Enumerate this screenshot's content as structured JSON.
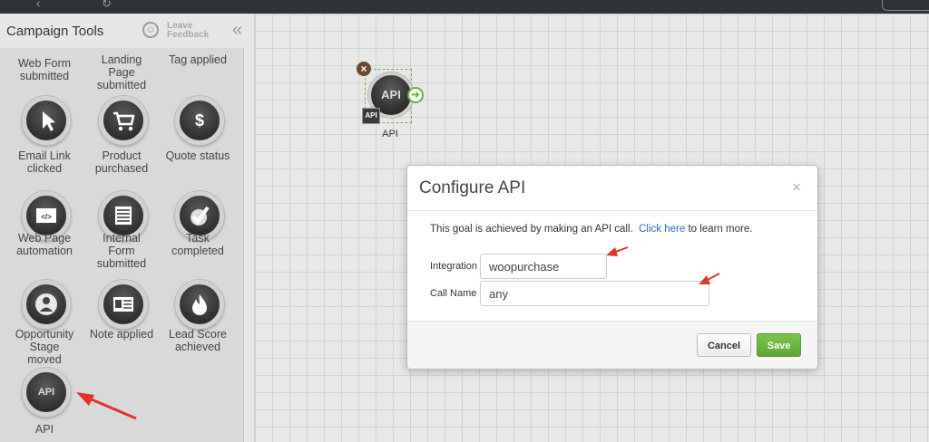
{
  "sidebar": {
    "title": "Campaign Tools",
    "feedback": "Leave\nFeedback",
    "collapse": "«",
    "tools": [
      {
        "label": "Web Form\nsubmitted"
      },
      {
        "label": "Landing\nPage\nsubmitted"
      },
      {
        "label": "Tag applied"
      },
      {
        "label": "Email Link\nclicked",
        "icon": "cursor-icon"
      },
      {
        "label": "Product\npurchased",
        "icon": "cart-icon"
      },
      {
        "label": "Quote status",
        "icon": "dollar-icon"
      },
      {
        "label": "Web Page\nautomation",
        "icon": "code-icon"
      },
      {
        "label": "Internal\nForm\nsubmitted",
        "icon": "form-icon"
      },
      {
        "label": "Task\ncompleted",
        "icon": "checkmark-icon"
      },
      {
        "label": "Opportunity\nStage\nmoved",
        "icon": "person-icon"
      },
      {
        "label": "Note applied",
        "icon": "note-card-icon"
      },
      {
        "label": "Lead Score\nachieved",
        "icon": "flame-icon"
      },
      {
        "label": "API",
        "icon_text": "API"
      }
    ]
  },
  "canvas": {
    "node": {
      "icon_text": "API",
      "badge": "API",
      "label": "API",
      "remove": "×",
      "next": "➔"
    }
  },
  "modal": {
    "title": "Configure API",
    "close": "×",
    "desc_before": "This goal is achieved by making an API call.",
    "link": "Click here",
    "desc_after": " to learn more.",
    "fields": [
      {
        "label": "Integration",
        "value": "woopurchase"
      },
      {
        "label": "Call Name",
        "value": "any"
      }
    ],
    "cancel": "Cancel",
    "save": "Save"
  },
  "colors": {
    "annotation": "#e2322b",
    "save": "#6bb13e",
    "link": "#2a6ebb"
  }
}
